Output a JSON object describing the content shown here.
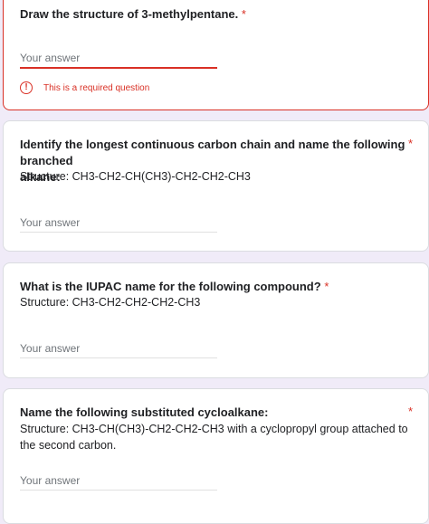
{
  "placeholder": "Your answer",
  "required_marker": "*",
  "questions": [
    {
      "title": "Draw the structure of 3-methylpentane.",
      "error": "This is a required question"
    },
    {
      "title_line1": "Identify the longest continuous carbon chain and name the following branched",
      "title_line2": "alkane:",
      "structure": "Structure: CH3-CH2-CH(CH3)-CH2-CH2-CH3"
    },
    {
      "title": "What is the IUPAC name for the following compound?",
      "structure": "Structure: CH3-CH2-CH2-CH2-CH3"
    },
    {
      "title": "Name the following substituted cycloalkane:",
      "structure_line1": "Structure: CH3-CH(CH3)-CH2-CH2-CH3 with a cyclopropyl group attached to",
      "structure_line2": "the second carbon."
    }
  ],
  "colors": {
    "error": "#d93025",
    "background": "#f0ebf8",
    "card": "#ffffff"
  }
}
